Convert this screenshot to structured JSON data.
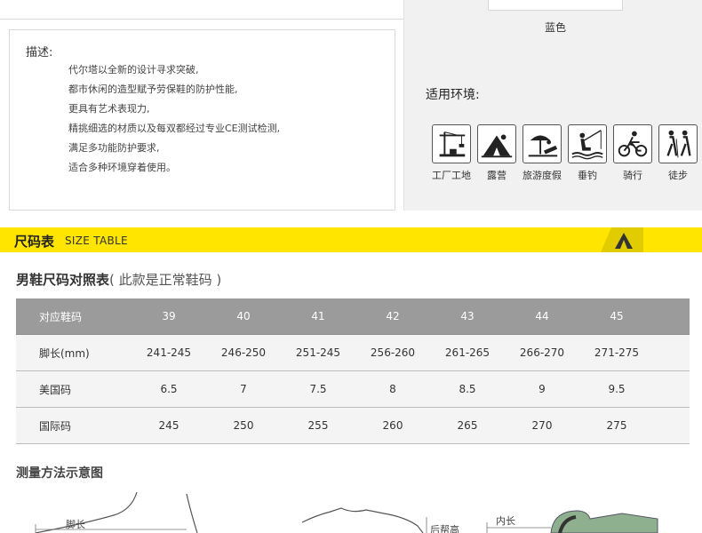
{
  "right_panel": {
    "color_label": "蓝色",
    "env_title": "适用环境:",
    "environments": [
      {
        "icon": "construction-site-icon",
        "label": "工厂工地"
      },
      {
        "icon": "camping-icon",
        "label": "露营"
      },
      {
        "icon": "vacation-icon",
        "label": "旅游度假"
      },
      {
        "icon": "fishing-icon",
        "label": "垂钓"
      },
      {
        "icon": "cycling-icon",
        "label": "骑行"
      },
      {
        "icon": "hiking-icon",
        "label": "徒步"
      }
    ]
  },
  "description": {
    "title": "描述:",
    "lines": [
      "代尔塔以全新的设计寻求突破,",
      "都市休闲的造型赋予劳保鞋的防护性能,",
      "更具有艺术表现力,",
      "精挑细选的材质以及每双都经过专业CE测试检测,",
      "满足多功能防护要求,",
      "适合多种环境穿着使用。"
    ]
  },
  "size_banner": {
    "cn": "尺码表",
    "en": "SIZE TABLE",
    "brand_color": "#ffe500"
  },
  "men_table": {
    "title": "男鞋尺码对照表",
    "subtitle": "( 此款是正常鞋码 )",
    "header": {
      "label": "对应鞋码",
      "values": [
        "39",
        "40",
        "41",
        "42",
        "43",
        "44",
        "45"
      ]
    },
    "rows": [
      {
        "label": "脚长(mm)",
        "values": [
          "241-245",
          "246-250",
          "251-245",
          "256-260",
          "261-265",
          "266-270",
          "271-275"
        ]
      },
      {
        "label": "美国码",
        "values": [
          "6.5",
          "7",
          "7.5",
          "8",
          "8.5",
          "9",
          "9.5"
        ]
      },
      {
        "label": "国际码",
        "values": [
          "245",
          "250",
          "255",
          "260",
          "265",
          "270",
          "275"
        ]
      }
    ]
  },
  "measure": {
    "title": "测量方法示意图",
    "labels": {
      "foot_length": "脚长",
      "heel_height": "后帮高",
      "inner_length": "内长"
    }
  }
}
